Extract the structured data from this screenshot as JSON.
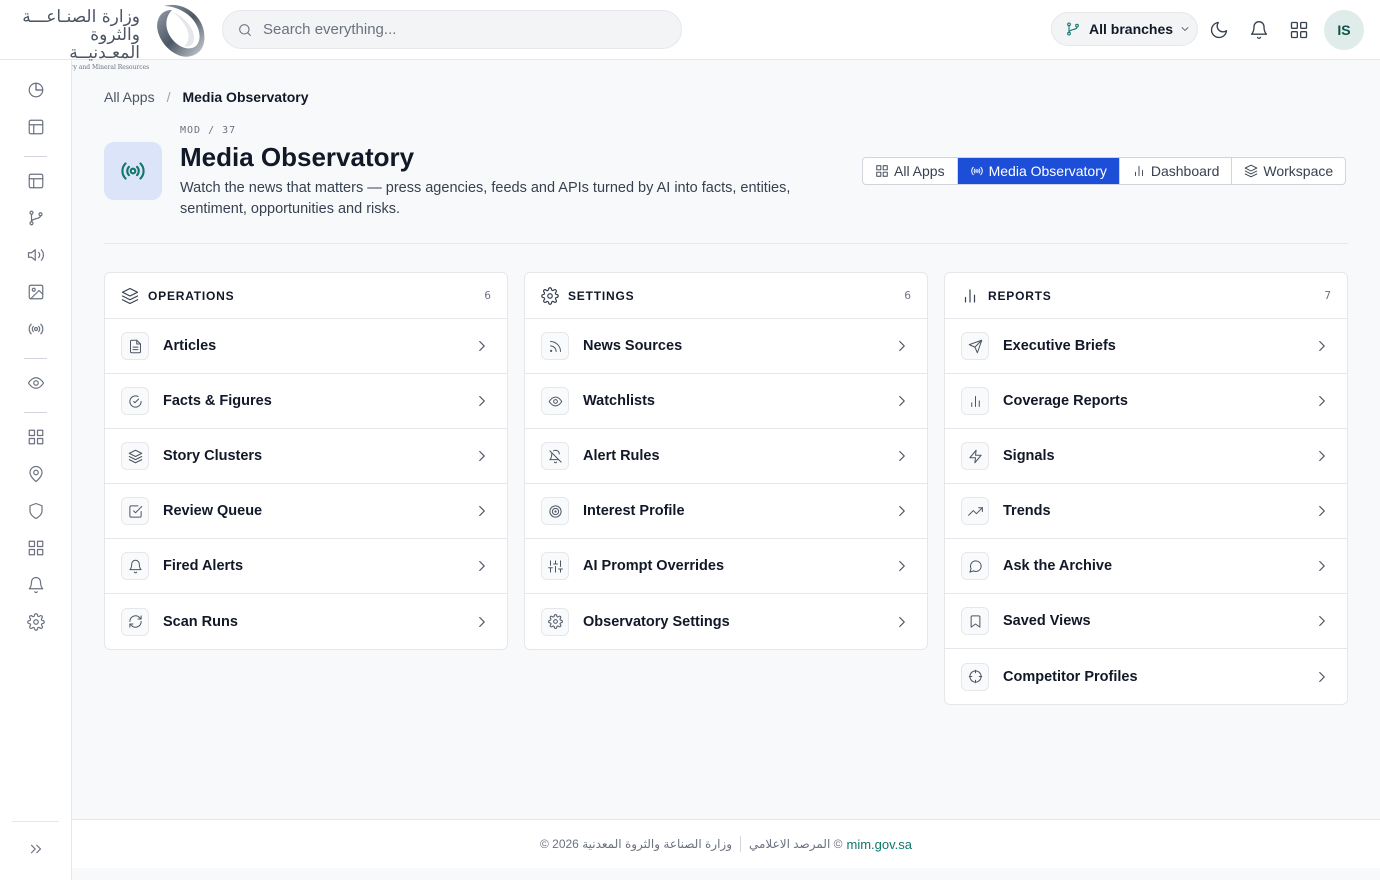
{
  "brand": {
    "logo_ar_line1": "وزارة الصنـاعـــة",
    "logo_ar_line2": "والثروة المعـدنيــة",
    "logo_en": "Ministry of Industry and Mineral Resources"
  },
  "search": {
    "placeholder": "Search everything..."
  },
  "header": {
    "branch_label": "All branches",
    "avatar_initials": "IS",
    "icons": [
      "git-branch-icon",
      "moon-icon",
      "bell-icon",
      "grid-icon"
    ]
  },
  "sidebar": {
    "items": [
      "pie-chart-icon",
      "layout-icon",
      "layout-icon",
      "git-branch-icon",
      "megaphone-icon",
      "image-icon",
      "broadcast-icon",
      "eye-icon",
      "grid-icon",
      "map-pin-icon",
      "shield-icon",
      "grid-icon",
      "bell-icon",
      "gear-icon"
    ],
    "expand_icon": "chevrons-right-icon"
  },
  "breadcrumb": {
    "root": "All Apps",
    "separator": "/",
    "current": "Media Observatory"
  },
  "module": {
    "code": "MOD / 37",
    "title": "Media Observatory",
    "description": "Watch the news that matters — press agencies, feeds and APIs turned by AI into facts, entities, sentiment, opportunities and risks.",
    "accent": "#0f766e"
  },
  "tabs": [
    {
      "label": "All Apps",
      "icon": "grid-icon",
      "active": false
    },
    {
      "label": "Media Observatory",
      "icon": "broadcast-icon",
      "active": true
    },
    {
      "label": "Dashboard",
      "icon": "bar-chart-icon",
      "active": false
    },
    {
      "label": "Workspace",
      "icon": "layers-icon",
      "active": false
    }
  ],
  "sections": [
    {
      "title": "OPERATIONS",
      "count": "6",
      "icon": "layers-icon",
      "items": [
        {
          "label": "Articles",
          "icon": "file-icon"
        },
        {
          "label": "Facts & Figures",
          "icon": "check-circle-icon"
        },
        {
          "label": "Story Clusters",
          "icon": "layers-icon"
        },
        {
          "label": "Review Queue",
          "icon": "check-square-icon"
        },
        {
          "label": "Fired Alerts",
          "icon": "bell-icon"
        },
        {
          "label": "Scan Runs",
          "icon": "refresh-icon"
        }
      ]
    },
    {
      "title": "SETTINGS",
      "count": "6",
      "icon": "gear-icon",
      "items": [
        {
          "label": "News Sources",
          "icon": "rss-icon"
        },
        {
          "label": "Watchlists",
          "icon": "eye-icon"
        },
        {
          "label": "Alert Rules",
          "icon": "bell-off-icon"
        },
        {
          "label": "Interest Profile",
          "icon": "target-icon"
        },
        {
          "label": "AI Prompt Overrides",
          "icon": "sliders-icon"
        },
        {
          "label": "Observatory Settings",
          "icon": "gear-icon"
        }
      ]
    },
    {
      "title": "REPORTS",
      "count": "7",
      "icon": "bar-chart-icon",
      "items": [
        {
          "label": "Executive Briefs",
          "icon": "send-icon"
        },
        {
          "label": "Coverage Reports",
          "icon": "bar-chart-icon"
        },
        {
          "label": "Signals",
          "icon": "zap-icon"
        },
        {
          "label": "Trends",
          "icon": "trending-up-icon"
        },
        {
          "label": "Ask the Archive",
          "icon": "message-circle-icon"
        },
        {
          "label": "Saved Views",
          "icon": "bookmark-icon"
        },
        {
          "label": "Competitor Profiles",
          "icon": "crosshair-icon"
        }
      ]
    }
  ],
  "footer": {
    "copyright": "© 2026 وزارة الصناعة والثروة المعدنية",
    "app_name": "المرصد الاعلامي ©",
    "link": "mim.gov.sa"
  }
}
